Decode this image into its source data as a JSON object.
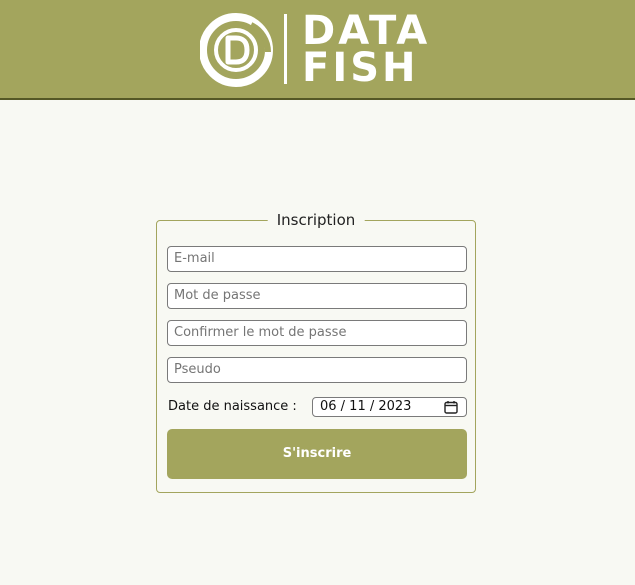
{
  "brand": {
    "logo_icon": "datafish-d-logo-icon",
    "name_line1": "DATA",
    "name_line2": "FISH"
  },
  "form": {
    "legend": "Inscription",
    "email_placeholder": "E-mail",
    "password_placeholder": "Mot de passe",
    "confirm_placeholder": "Confirmer le mot de passe",
    "username_placeholder": "Pseudo",
    "birthdate_label": "Date de naissance :",
    "birthdate_value": "06 / 11 / 2023",
    "submit_label": "S'inscrire"
  },
  "colors": {
    "header": "#a3a55d",
    "header_border": "#555826",
    "page_background": "#f8f9f3",
    "button": "#a3a55d"
  }
}
